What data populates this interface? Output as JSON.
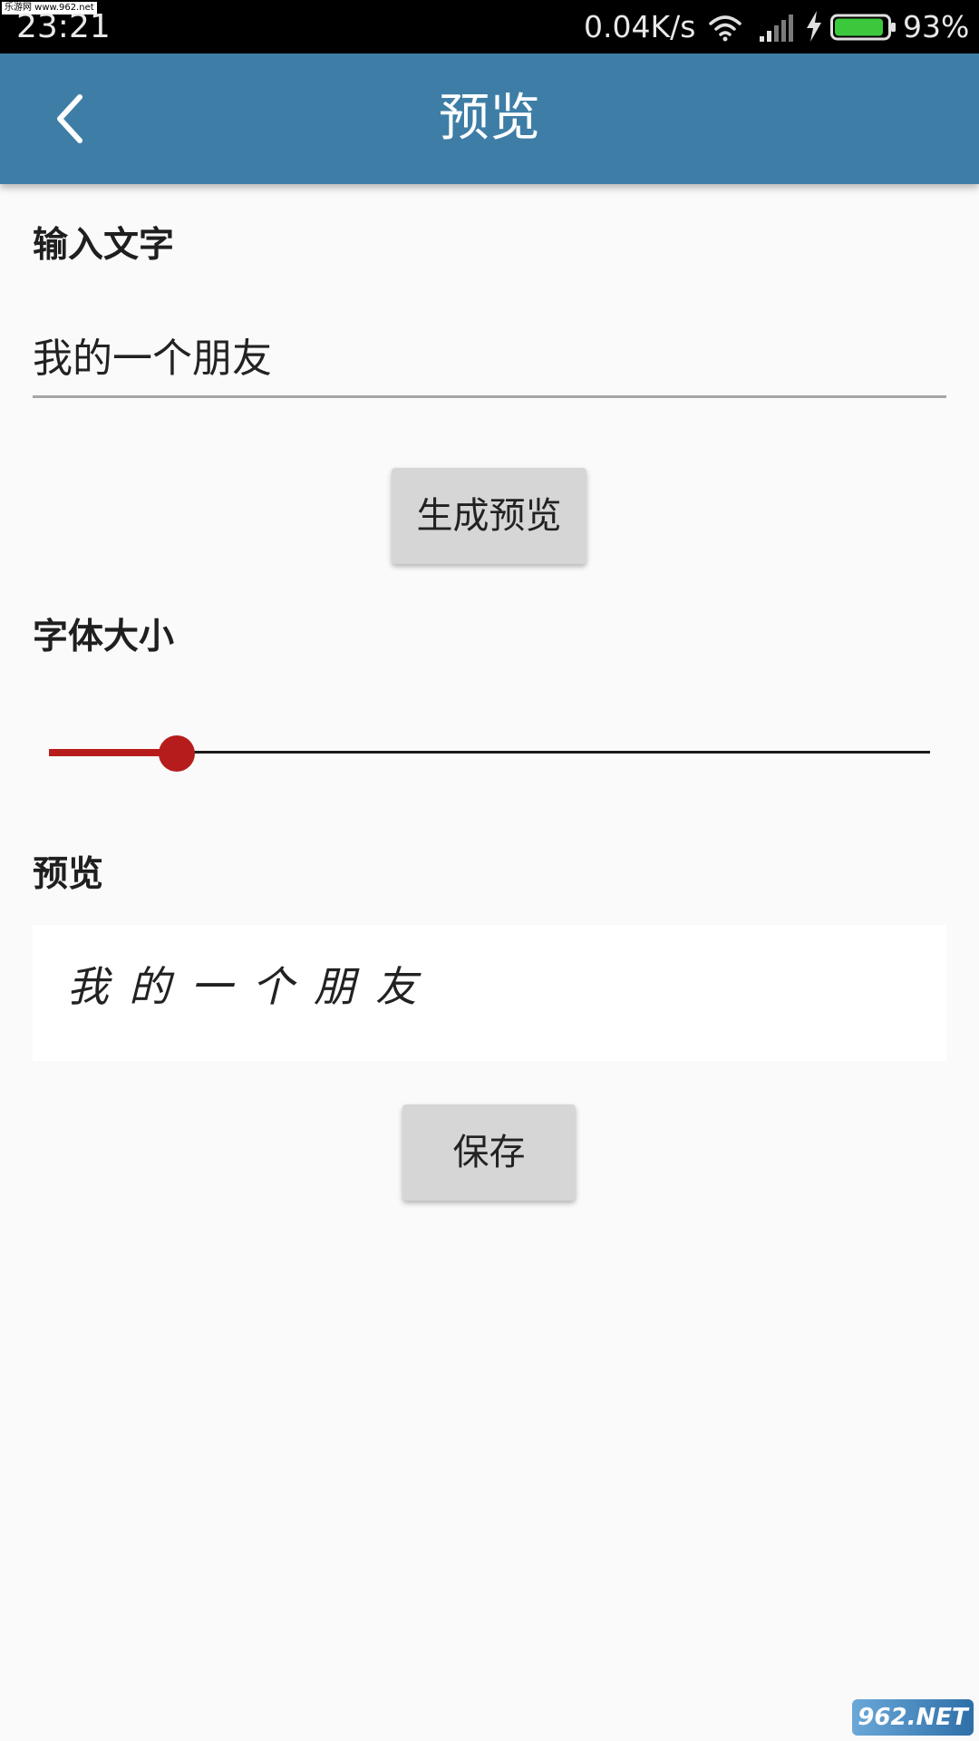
{
  "status_bar": {
    "time": "23:21",
    "watermark": "乐游网 www.962.net",
    "network_speed": "0.04K/s",
    "battery_percent": "93%",
    "battery_level": 0.93,
    "icons": [
      "wifi-icon",
      "signal-icon",
      "charging-icon",
      "battery-icon"
    ]
  },
  "app_bar": {
    "back_icon": "chevron-left-icon",
    "title": "预览"
  },
  "form": {
    "input_label": "输入文字",
    "input_value": "我的一个朋友",
    "generate_button": "生成预览",
    "font_size_label": "字体大小",
    "font_size_slider_value": 0.145,
    "preview_label": "预览",
    "preview_text": "我的一个朋友",
    "save_button": "保存"
  },
  "watermark_bottom": "962.NET 乐游网",
  "colors": {
    "app_bar": "#3e7ea6",
    "accent": "#b71c1c",
    "button": "#d6d6d6",
    "background": "#fafafa"
  }
}
